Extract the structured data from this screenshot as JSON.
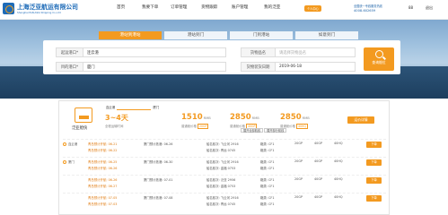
{
  "brand": {
    "name": "上海泛亚航运有限公司",
    "sub": "Shanghai PAN-ASIA Shipping Co.,Ltd"
  },
  "nav": [
    "首页",
    "我要下单",
    "订单管理",
    "货物跟踪",
    "账户管理",
    "我的泛亚"
  ],
  "badge": "个人中心",
  "phone_label": "全国统一专线服务热线",
  "phone": "4008-602659",
  "user": "退出",
  "user_name": "88",
  "tabs": [
    "港站到港站",
    "港站到门",
    "门到港站",
    "如意到门"
  ],
  "form": {
    "origin_label": "起运港口*",
    "origin_value": "连云港",
    "dest_label": "目的港口*",
    "dest_value": "厦门",
    "cargo_label": "货物品名",
    "cargo_value": "请选择货物品名",
    "date_label": "货物装货日期",
    "date_value": "2019-06-18",
    "search": "查询舱位"
  },
  "summary": {
    "carrier": "泛亚舱快",
    "route_from": "连云港",
    "route_to": "厦门",
    "days": "3~4天",
    "days_sub": "全程运输时间",
    "prices": [
      {
        "value": "1510",
        "unit": "RMB",
        "sub": "普通舱价格",
        "tag": "20GP"
      },
      {
        "value": "2850",
        "unit": "RMB",
        "sub": "普通舱价格",
        "tag": "40GP"
      },
      {
        "value": "2850",
        "unit": "RMB",
        "sub": "普通舱价格",
        "tag": "40HQ"
      }
    ],
    "detail": "运价详情",
    "toggle_a": "展开全部航线",
    "toggle_b": "展开部分航线"
  },
  "schedules": [
    {
      "r1": "连云港",
      "r1b": "青岛预计开航: 06-21",
      "d1": "青岛预计开航: 06-22",
      "d2": "厦门预计抵港: 06-26",
      "v1": "船名航次: 飞云河 2916",
      "v2": "船名航次: 青远 0745",
      "s1": "箱类: CF1",
      "s2": "箱类: CF1",
      "g": "20GP",
      "h": "40GP",
      "k": "40HQ",
      "book": "下单"
    },
    {
      "r1": "厦门",
      "r1b": "青岛预计开航: 06-25",
      "d1": "青岛预计开航: 06-26",
      "d2": "厦门预计抵港: 06-30",
      "v1": "船名航次: 飞云河 2916",
      "v2": "船名航次: 金福 0753",
      "s1": "箱类: CF1",
      "s2": "箱类: CF1",
      "g": "20GP",
      "h": "40GP",
      "k": "40HQ",
      "book": "下单"
    },
    {
      "r1": "",
      "r1b": "青岛预计开航: 06-26",
      "d1": "青岛预计开航: 06-27",
      "d2": "厦门预计抵港: 07-01",
      "v1": "船名航次: 泛亚 2956",
      "v2": "船名航次: 金福 0753",
      "s1": "箱类: CF1",
      "s2": "箱类: CF1",
      "g": "20GP",
      "h": "40GP",
      "k": "40HQ",
      "book": "下单"
    },
    {
      "r1": "",
      "r1b": "青岛预计开航: 07-05",
      "d1": "青岛预计开航: 07-03",
      "d2": "厦门预计抵港: 07-08",
      "v1": "船名航次: 飞云河 2916",
      "v2": "船名航次: 青远 0745",
      "s1": "箱类: CF1",
      "s2": "箱类: CF1",
      "g": "20GP",
      "h": "40GP",
      "k": "40HQ",
      "book": "下单"
    }
  ]
}
